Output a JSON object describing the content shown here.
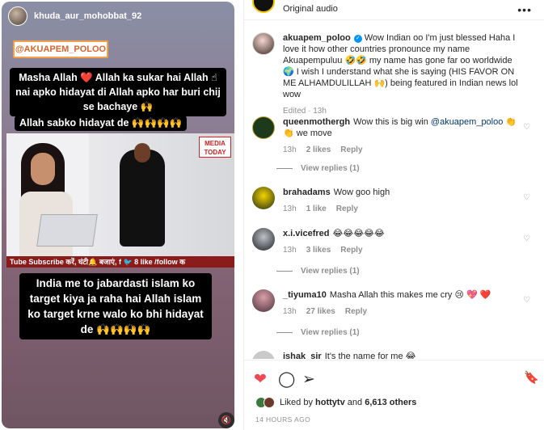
{
  "reel": {
    "username": "khuda_aur_mohobbat_92",
    "tag": "@AKUAPEM_POLOO",
    "caption_top": "Masha Allah ❤️ Allah ka sukar hai Allah ☝ nai apko hidayat di Allah apko har buri chij se bachaye 🙌",
    "caption_mid": "Allah sabko hidayat de 🙌🙌🙌🙌",
    "news_logo": "MEDIA TODAY",
    "ticker": "Tube Subscribe करें, घंटी🔔 बजाएं, f 🐦 8 like /follow क",
    "caption_bottom": "India me to jabardasti islam ko target kiya ja raha hai Allah islam ko target krne walo ko bhi hidayat de 🙌🙌🙌🙌",
    "mute_icon": "🔇"
  },
  "header": {
    "audio": "Original audio",
    "more": "•••"
  },
  "comments": [
    {
      "user": "akuapem_poloo",
      "verified": "✓",
      "text": "Wow Indian oo I'm just blessed Haha I love it how other countries pronounce my name Akuapempuluu 🤣🤣 my name has gone far oo worldwide 🌍 I wish I understand what she is saying (HIS FAVOR ON ME ALHAMDULILLAH 🙌) being featured in Indian news lol wow",
      "time": "Edited · 13h"
    },
    {
      "user": "queenmothergh",
      "text_before": "Wow this is big win",
      "mention": "@akuapem_poloo",
      "text_after": "👏👏 we move",
      "time": "13h",
      "likes": "2 likes",
      "reply": "Reply",
      "view_replies": "View replies (1)"
    },
    {
      "user": "brahadams",
      "text": "Wow goo high",
      "time": "13h",
      "likes": "1 like",
      "reply": "Reply"
    },
    {
      "user": "x.i.vicefred",
      "text": "😂😂😂😂😂",
      "time": "13h",
      "likes": "3 likes",
      "reply": "Reply",
      "view_replies": "View replies (1)"
    },
    {
      "user": "_tiyuma10",
      "text": "Masha Allah this makes me cry 😢 💖 ❤️",
      "time": "13h",
      "likes": "27 likes",
      "reply": "Reply",
      "view_replies": "View replies (1)"
    },
    {
      "user": "ishak_sir",
      "text": "It's the name for me 😂"
    }
  ],
  "actions": {
    "like_icon": "❤",
    "comment_icon": "◯",
    "share_icon": "➢",
    "save_icon": "🔖",
    "liked_by_prefix": "Liked by",
    "liked_by_user": "hottytv",
    "liked_by_and": "and",
    "liked_by_count": "6,613 others",
    "time_ago": "14 HOURS AGO"
  }
}
